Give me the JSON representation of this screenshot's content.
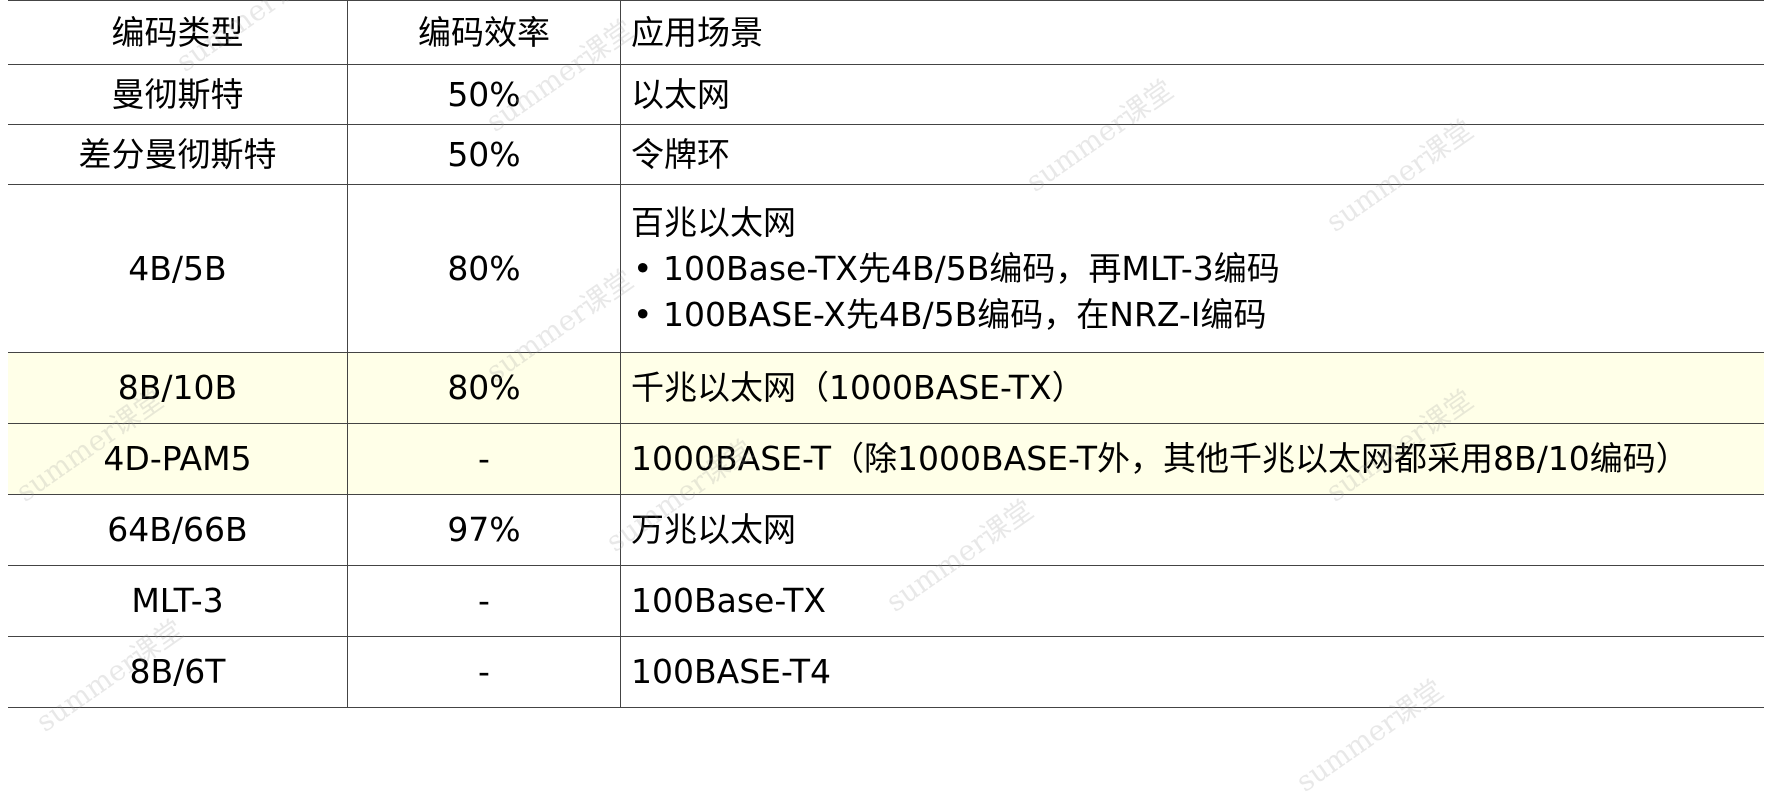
{
  "header": {
    "col1": "编码类型",
    "col2": "编码效率",
    "col3": "应用场景"
  },
  "rows": [
    {
      "type": "曼彻斯特",
      "efficiency": "50%",
      "scenario": "以太网"
    },
    {
      "type": "差分曼彻斯特",
      "efficiency": "50%",
      "scenario": "令牌环"
    },
    {
      "type": "4B/5B",
      "efficiency": "80%",
      "scenario": "百兆以太网",
      "bullets": [
        "100Base-TX先4B/5B编码，再MLT-3编码",
        "100BASE-X先4B/5B编码，在NRZ-I编码"
      ]
    },
    {
      "type": "8B/10B",
      "efficiency": "80%",
      "scenario": "千兆以太网（1000BASE-TX）",
      "highlight": true
    },
    {
      "type": "4D-PAM5",
      "efficiency": "-",
      "scenario": "1000BASE-T（除1000BASE-T外，其他千兆以太网都采用8B/10编码）",
      "highlight": true
    },
    {
      "type": "64B/66B",
      "efficiency": "97%",
      "scenario": "万兆以太网"
    },
    {
      "type": "MLT-3",
      "efficiency": "-",
      "scenario": "100Base-TX"
    },
    {
      "type": "8B/6T",
      "efficiency": "-",
      "scenario": "100BASE-T4"
    }
  ],
  "watermark": "summer课堂",
  "colors": {
    "highlight_row": "#ffffe8",
    "border": "#444444"
  }
}
